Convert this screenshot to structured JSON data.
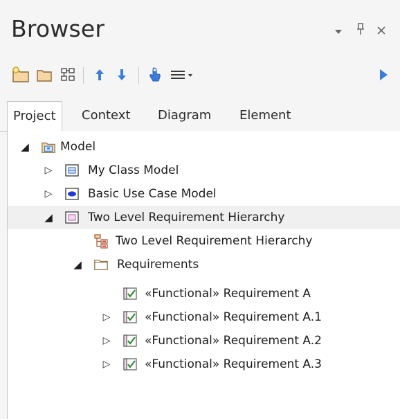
{
  "window": {
    "title": "Browser",
    "dropdown_icon": "chevron-down-icon",
    "pin_icon": "pin-icon",
    "close_icon": "close-icon"
  },
  "toolbar": {
    "buttons": [
      {
        "name": "new-package-button",
        "icon": "new-package-icon"
      },
      {
        "name": "new-folder-button",
        "icon": "folder-icon"
      },
      {
        "name": "new-diagram-button",
        "icon": "diagram-icon"
      },
      {
        "name": "move-up-button",
        "icon": "arrow-up-icon"
      },
      {
        "name": "move-down-button",
        "icon": "arrow-down-icon"
      },
      {
        "name": "locate-button",
        "icon": "locate-icon"
      },
      {
        "name": "menu-button",
        "icon": "menu-icon"
      },
      {
        "name": "expand-toolbar-button",
        "icon": "play-icon"
      }
    ]
  },
  "tabs": [
    {
      "label": "Project",
      "active": true
    },
    {
      "label": "Context",
      "active": false
    },
    {
      "label": "Diagram",
      "active": false
    },
    {
      "label": "Element",
      "active": false
    }
  ],
  "tree": [
    {
      "label": "Model",
      "level": 0,
      "expanded": true,
      "icon": "model-root-icon"
    },
    {
      "label": "My Class Model",
      "level": 1,
      "expanded": false,
      "icon": "class-package-icon"
    },
    {
      "label": "Basic Use Case Model",
      "level": 1,
      "expanded": false,
      "icon": "use-case-package-icon"
    },
    {
      "label": "Two Level Requirement Hierarchy",
      "level": 1,
      "expanded": true,
      "icon": "requirement-package-icon",
      "selected": true
    },
    {
      "label": "Two Level Requirement Hierarchy",
      "level": 2,
      "expanded": null,
      "icon": "hierarchy-diagram-icon"
    },
    {
      "label": "Requirements",
      "level": 2,
      "expanded": true,
      "icon": "folder-icon"
    },
    {
      "label": "«Functional» Requirement A",
      "level": 3,
      "expanded": null,
      "icon": "requirement-check-icon"
    },
    {
      "label": "«Functional» Requirement A.1",
      "level": 3,
      "expanded": false,
      "icon": "requirement-check-icon"
    },
    {
      "label": "«Functional» Requirement A.2",
      "level": 3,
      "expanded": false,
      "icon": "requirement-check-icon"
    },
    {
      "label": "«Functional» Requirement A.3",
      "level": 3,
      "expanded": false,
      "icon": "requirement-check-icon"
    }
  ],
  "colors": {
    "accent_blue": "#3b7ddd",
    "folder_fill": "#f6d7a4",
    "folder_stroke": "#8a6a3a",
    "requirement_green": "#2e8b2e",
    "requirement_fill": "#f3d7f0",
    "selection": "#f0f0f0"
  }
}
